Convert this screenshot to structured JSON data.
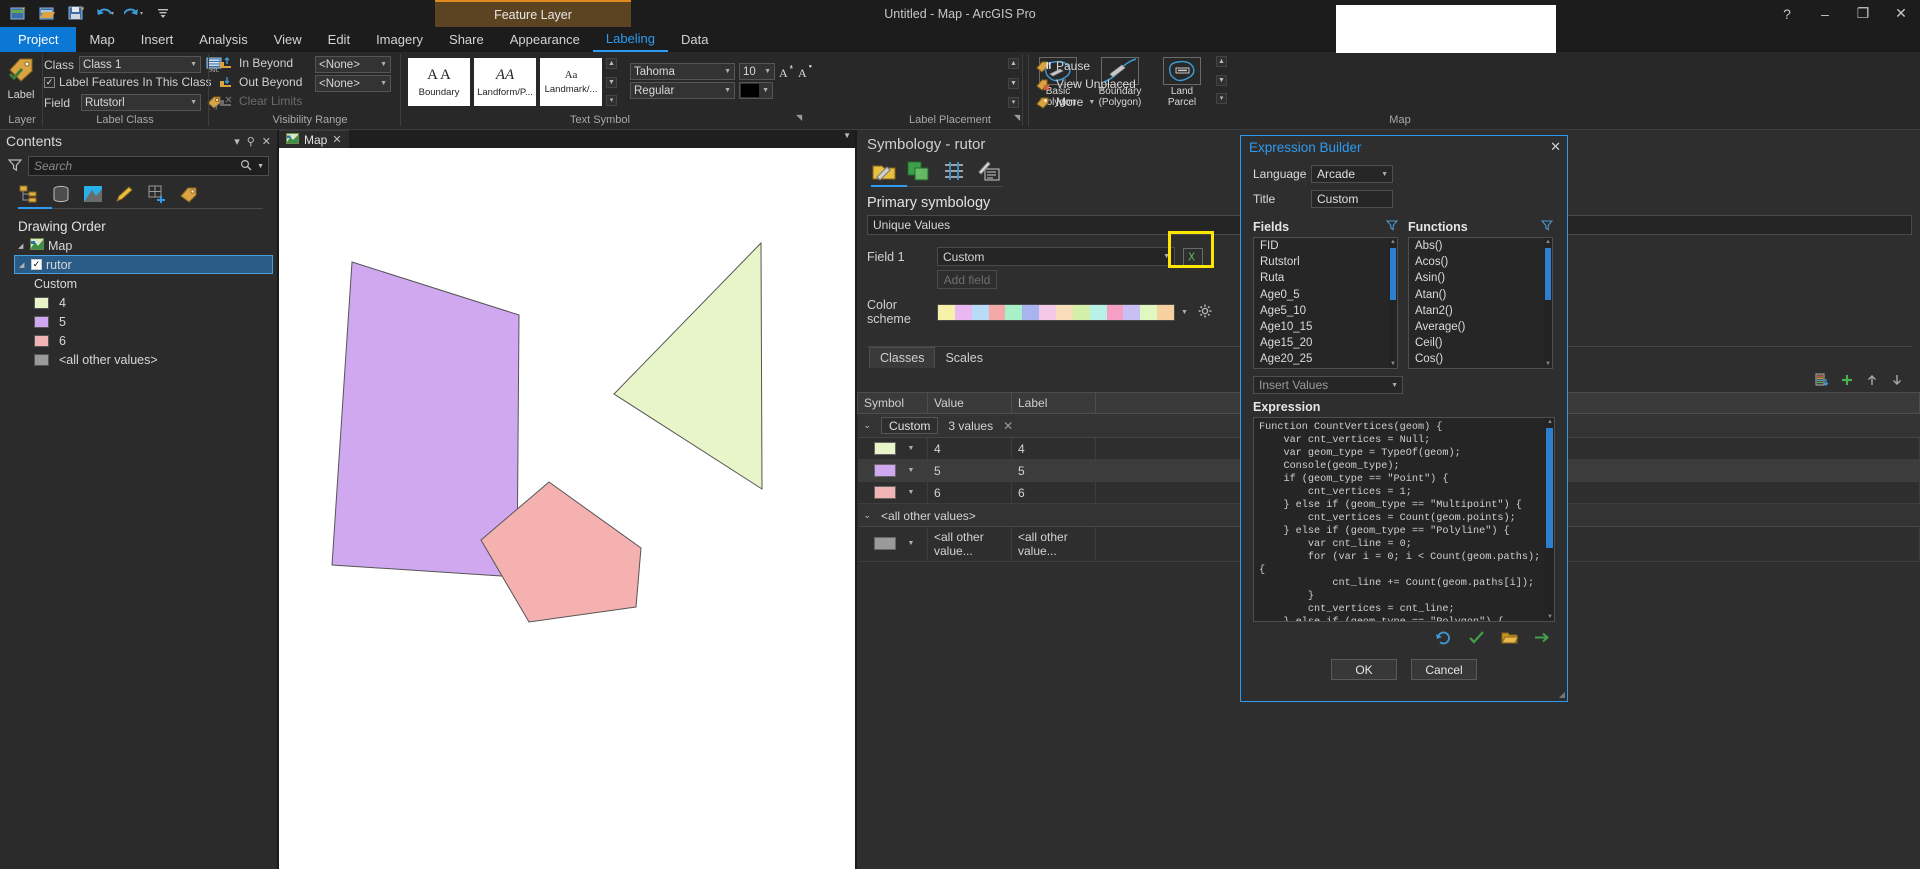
{
  "titlebar": {
    "window_title": "Untitled - Map - ArcGIS Pro",
    "contextual_tab": "Feature Layer",
    "help_icon": "help-icon",
    "minimize": "–",
    "maximize": "❐",
    "close": "✕",
    "qat": [
      {
        "name": "new-project-icon"
      },
      {
        "name": "open-project-icon"
      },
      {
        "name": "save-project-icon"
      },
      {
        "name": "undo-icon"
      },
      {
        "name": "redo-icon"
      },
      {
        "name": "customize-qat-icon"
      }
    ]
  },
  "ribbon_tabs": [
    {
      "label": "Project",
      "active": false,
      "style": "project"
    },
    {
      "label": "Map",
      "active": false
    },
    {
      "label": "Insert",
      "active": false
    },
    {
      "label": "Analysis",
      "active": false
    },
    {
      "label": "View",
      "active": false
    },
    {
      "label": "Edit",
      "active": false
    },
    {
      "label": "Imagery",
      "active": false
    },
    {
      "label": "Share",
      "active": false
    },
    {
      "label": "Appearance",
      "active": false
    },
    {
      "label": "Labeling",
      "active": true
    },
    {
      "label": "Data",
      "active": false
    }
  ],
  "ribbon": {
    "groups": [
      {
        "label": "Layer"
      },
      {
        "label": "Label Class"
      },
      {
        "label": "Visibility Range"
      },
      {
        "label": "Text Symbol"
      },
      {
        "label": "Label Placement"
      },
      {
        "label": "Map"
      }
    ],
    "label_button": "Label",
    "label_class": {
      "class_label": "Class",
      "class_value": "Class 1",
      "sql_icon": "sql-query-icon",
      "label_features_checkbox": "Label Features In This Class",
      "field_label": "Field",
      "field_value": "Rutstorl",
      "field_expression_icon": "label-expression-icon"
    },
    "visibility": {
      "in_beyond": "In Beyond",
      "out_beyond": "Out Beyond",
      "clear_limits": "Clear Limits",
      "in_beyond_value": "<None>",
      "out_beyond_value": "<None>"
    },
    "text_symbol": {
      "gallery": [
        {
          "preview": "A A",
          "name": "Boundary"
        },
        {
          "preview": "AA",
          "name": "Landform/P..."
        },
        {
          "preview": "Aa",
          "name": "Landmark/..."
        }
      ],
      "font_family": "Tahoma",
      "font_size": "10",
      "font_style": "Regular",
      "increase_size_icon": "increase-font-size-icon",
      "decrease_size_icon": "decrease-font-size-icon",
      "text_color": "#000000"
    },
    "label_placement": [
      {
        "name": "Basic\nPolygon",
        "line1": "Basic",
        "line2": "Polygon",
        "icon": "basic-polygon-icon"
      },
      {
        "name": "Boundary (Polygon)",
        "line1": "Boundary",
        "line2": "(Polygon)",
        "icon": "boundary-polygon-icon"
      },
      {
        "name": "Land Parcel",
        "line1": "Land",
        "line2": "Parcel",
        "icon": "land-parcel-icon"
      }
    ],
    "map_group": [
      {
        "label": "Pause",
        "icon": "pause-labeling-icon"
      },
      {
        "label": "View Unplaced",
        "icon": "view-unplaced-icon"
      },
      {
        "label": "More",
        "icon": "more-labeling-icon"
      }
    ]
  },
  "contents": {
    "title": "Contents",
    "dropdown_icon": "pane-menu-icon",
    "pin_icon": "pin-icon",
    "close_icon": "close-icon",
    "search_placeholder": "Search",
    "filter_icon": "filter-icon",
    "search_icon": "search-icon",
    "tabs": [
      {
        "name": "list-by-drawing-order-icon",
        "active": true
      },
      {
        "name": "list-by-data-source-icon",
        "active": false
      },
      {
        "name": "list-by-selection-icon",
        "active": false
      },
      {
        "name": "list-by-editing-icon",
        "active": false
      },
      {
        "name": "list-by-snapping-icon",
        "active": false
      },
      {
        "name": "list-by-labeling-icon",
        "active": true
      }
    ],
    "drawing_order": "Drawing Order",
    "tree": [
      {
        "label": "Map",
        "type": "map",
        "icon": "map-icon"
      },
      {
        "label": "rutor",
        "type": "layer",
        "selected": true,
        "checked": true
      },
      {
        "label": "Custom",
        "type": "heading"
      },
      {
        "label": "4",
        "type": "class",
        "color": "#e8f5c8"
      },
      {
        "label": "5",
        "type": "class",
        "color": "#cfa8f0"
      },
      {
        "label": "6",
        "type": "class",
        "color": "#f0b4b4"
      },
      {
        "label": "<all other values>",
        "type": "class",
        "color": "#9a9a9a"
      }
    ]
  },
  "map_view": {
    "tab_label": "Map",
    "tab_icon": "map-icon",
    "close_icon": "✕",
    "features": [
      {
        "name": "polygon-purple",
        "fill": "#cfa8f0",
        "stroke": "#555555"
      },
      {
        "name": "polygon-green",
        "fill": "#e8f5c8",
        "stroke": "#555555"
      },
      {
        "name": "polygon-pink",
        "fill": "#f5b0b0",
        "stroke": "#555555"
      }
    ]
  },
  "symbology": {
    "title": "Symbology - rutor",
    "tabs": [
      {
        "name": "primary-symbology-icon",
        "active": true
      },
      {
        "name": "vary-symbology-by-attribute-icon",
        "active": false
      },
      {
        "name": "symbol-layer-drawing-icon",
        "active": false
      },
      {
        "name": "display-filters-icon",
        "active": false
      }
    ],
    "primary_heading": "Primary symbology",
    "primary_value": "Unique Values",
    "field1_label": "Field 1",
    "field1_value": "Custom",
    "expression_icon": "set-expression-icon",
    "add_field_label": "Add field",
    "color_scheme_label": "Color scheme",
    "color_scheme_swatches": [
      "#f7f0a8",
      "#e9b8f2",
      "#b8dcf5",
      "#f5a8a8",
      "#a8f0c8",
      "#a8b4f0",
      "#f2c8e6",
      "#f7ddb8",
      "#d2f0a8",
      "#b8f2e6",
      "#f79ec4",
      "#c8c0f5",
      "#e0f7c0",
      "#f7d0a0"
    ],
    "color_scheme_options_icon": "color-scheme-options-icon",
    "subtabs": [
      {
        "label": "Classes",
        "active": true
      },
      {
        "label": "Scales",
        "active": false
      }
    ],
    "toolbar_icons": [
      {
        "name": "more-values-icon"
      },
      {
        "name": "add-values-icon"
      },
      {
        "name": "move-up-icon"
      },
      {
        "name": "move-down-icon"
      }
    ],
    "table": {
      "columns": [
        "Symbol",
        "Value",
        "Label",
        ""
      ],
      "group": {
        "name": "Custom",
        "count": "3 values",
        "remove_icon": "✕"
      },
      "rows": [
        {
          "symbol_color": "#e8f5c8",
          "value": "4",
          "label": "4",
          "selected": false
        },
        {
          "symbol_color": "#cfa8f0",
          "value": "5",
          "label": "5",
          "selected": true
        },
        {
          "symbol_color": "#f0b4b4",
          "value": "6",
          "label": "6",
          "selected": false
        }
      ],
      "other_group": {
        "name": "<all other values>"
      },
      "other_row": {
        "symbol_color": "#9a9a9a",
        "value": "<all other value...",
        "label": "<all other value..."
      }
    }
  },
  "expression_builder": {
    "title": "Expression Builder",
    "close_icon": "✕",
    "language_label": "Language",
    "language_value": "Arcade",
    "title_label": "Title",
    "title_value": "Custom",
    "fields_label": "Fields",
    "fields_filter_icon": "filter-icon",
    "fields": [
      "FID",
      "Rutstorl",
      "Ruta",
      "Age0_5",
      "Age5_10",
      "Age10_15",
      "Age15_20",
      "Age20_25"
    ],
    "functions_label": "Functions",
    "functions_filter_icon": "filter-icon",
    "functions": [
      "Abs()",
      "Acos()",
      "Asin()",
      "Atan()",
      "Atan2()",
      "Average()",
      "Ceil()",
      "Cos()"
    ],
    "insert_values_label": "Insert Values",
    "expression_label": "Expression",
    "expression_code": "Function CountVertices(geom) {\n    var cnt_vertices = Null;\n    var geom_type = TypeOf(geom);\n    Console(geom_type);\n    if (geom_type == \"Point\") {\n        cnt_vertices = 1;\n    } else if (geom_type == \"Multipoint\") {\n        cnt_vertices = Count(geom.points);\n    } else if (geom_type == \"Polyline\") {\n        var cnt_line = 0;\n        for (var i = 0; i < Count(geom.paths); i++)\n{\n            cnt_line += Count(geom.paths[i]);\n        }\n        cnt_vertices = cnt_line;\n    } else if (geom_type == \"Polygon\") {",
    "action_icons": [
      {
        "name": "reset-icon"
      },
      {
        "name": "verify-icon"
      },
      {
        "name": "open-expression-icon"
      },
      {
        "name": "export-expression-icon"
      }
    ],
    "ok_label": "OK",
    "cancel_label": "Cancel"
  },
  "highlight": {
    "name": "expression-button-highlight",
    "color": "#ffe600"
  }
}
